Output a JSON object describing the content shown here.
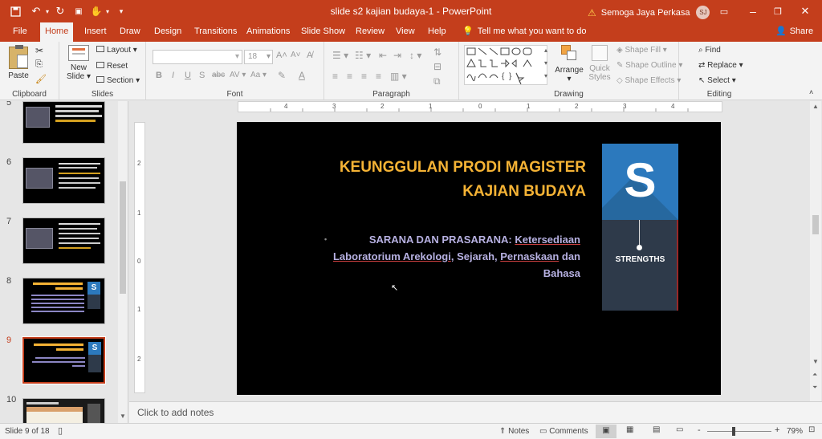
{
  "window": {
    "title": "slide s2 kajian budaya-1  -  PowerPoint",
    "warning_text": "Semoga Jaya Perkasa",
    "user_initials": "SJ",
    "accent_color": "#c43e1c"
  },
  "tabs": [
    "File",
    "Home",
    "Insert",
    "Draw",
    "Design",
    "Transitions",
    "Animations",
    "Slide Show",
    "Review",
    "View",
    "Help"
  ],
  "tell_me": "Tell me what you want to do",
  "share": "Share",
  "ribbon": {
    "clipboard": {
      "paste": "Paste",
      "label": "Clipboard"
    },
    "slides": {
      "new_slide_1": "New",
      "new_slide_2": "Slide",
      "layout": "Layout",
      "reset": "Reset",
      "section": "Section",
      "label": "Slides"
    },
    "font": {
      "size": "18",
      "label": "Font"
    },
    "paragraph": {
      "label": "Paragraph"
    },
    "drawing": {
      "arrange": "Arrange",
      "quick_1": "Quick",
      "quick_2": "Styles",
      "shape_fill": "Shape Fill",
      "shape_outline": "Shape Outline",
      "shape_effects": "Shape Effects",
      "label": "Drawing"
    },
    "editing": {
      "find": "Find",
      "replace": "Replace",
      "select": "Select",
      "label": "Editing"
    }
  },
  "ruler": {
    "h_ticks": [
      "4",
      "3",
      "2",
      "1",
      "0",
      "1",
      "2",
      "3",
      "4"
    ],
    "v_ticks": [
      "2",
      "1",
      "0",
      "1",
      "2"
    ]
  },
  "thumbnails": [
    {
      "num": "5",
      "selected": false
    },
    {
      "num": "6",
      "selected": false
    },
    {
      "num": "7",
      "selected": false
    },
    {
      "num": "8",
      "selected": false
    },
    {
      "num": "9",
      "selected": true
    },
    {
      "num": "10",
      "selected": false
    }
  ],
  "slide": {
    "title_line1": "KEUNGGULAN PRODI MAGISTER",
    "title_line2": "KAJIAN BUDAYA",
    "bullet_prefix": "SARANA DAN PRASARANA: ",
    "link1": "Ketersediaan",
    "link2": "Laboratorium Arekologi",
    "sep1": ", Sejarah, ",
    "link3": "Pernaskaan",
    "tail1": " dan",
    "tail2": "Bahasa",
    "badge_letter": "S",
    "badge_label": "STRENGTHS",
    "title_color": "#f5b335",
    "body_color": "#b7b1e2",
    "badge_blue": "#2c79bd",
    "badge_dark": "#2e3a4a"
  },
  "notes_placeholder": "Click to add notes",
  "status": {
    "slide_info": "Slide 9 of 18",
    "notes": "Notes",
    "comments": "Comments",
    "zoom": "79%",
    "zoom_minus": "-",
    "zoom_plus": "+"
  }
}
